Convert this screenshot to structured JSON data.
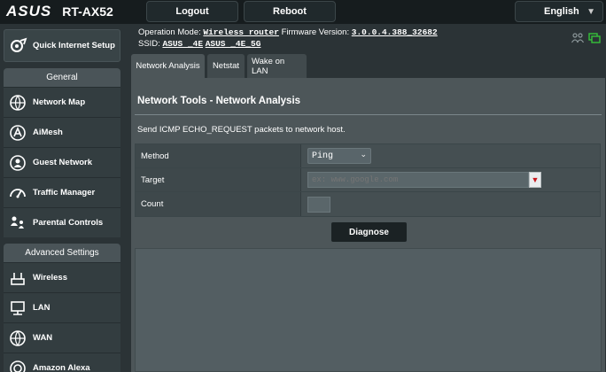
{
  "header": {
    "brand": "ASUS",
    "model": "RT-AX52",
    "logout_label": "Logout",
    "reboot_label": "Reboot",
    "language": "English"
  },
  "info": {
    "op_mode_label": "Operation Mode:",
    "op_mode_value": "Wireless router",
    "firmware_label": "Firmware Version:",
    "firmware_value": "3.0.0.4.388_32682",
    "ssid_label": "SSID:",
    "ssid_1": "ASUS _4E",
    "ssid_2": "ASUS _4E_5G"
  },
  "sidebar": {
    "quick_setup_label": "Quick Internet Setup",
    "general_header": "General",
    "general_items": [
      {
        "label": "Network Map",
        "icon": "network-map-icon"
      },
      {
        "label": "AiMesh",
        "icon": "aimesh-icon"
      },
      {
        "label": "Guest Network",
        "icon": "guest-network-icon"
      },
      {
        "label": "Traffic Manager",
        "icon": "traffic-manager-icon"
      },
      {
        "label": "Parental Controls",
        "icon": "parental-controls-icon"
      }
    ],
    "advanced_header": "Advanced Settings",
    "advanced_items": [
      {
        "label": "Wireless",
        "icon": "wireless-icon"
      },
      {
        "label": "LAN",
        "icon": "lan-icon"
      },
      {
        "label": "WAN",
        "icon": "wan-icon"
      },
      {
        "label": "Amazon Alexa",
        "icon": "alexa-icon"
      }
    ]
  },
  "tabs": [
    {
      "label": "Network Analysis",
      "active": true
    },
    {
      "label": "Netstat",
      "active": false
    },
    {
      "label": "Wake on LAN",
      "active": false
    }
  ],
  "main": {
    "title": "Network Tools - Network Analysis",
    "description": "Send ICMP ECHO_REQUEST packets to network host.",
    "rows": {
      "method_label": "Method",
      "method_value": "Ping",
      "target_label": "Target",
      "target_placeholder": "ex: www.google.com",
      "count_label": "Count",
      "count_value": ""
    },
    "diagnose_label": "Diagnose"
  },
  "colors": {
    "accent_green": "#35c23a",
    "combo_arrow_red": "#c8181e",
    "panel": "#4d5659"
  }
}
